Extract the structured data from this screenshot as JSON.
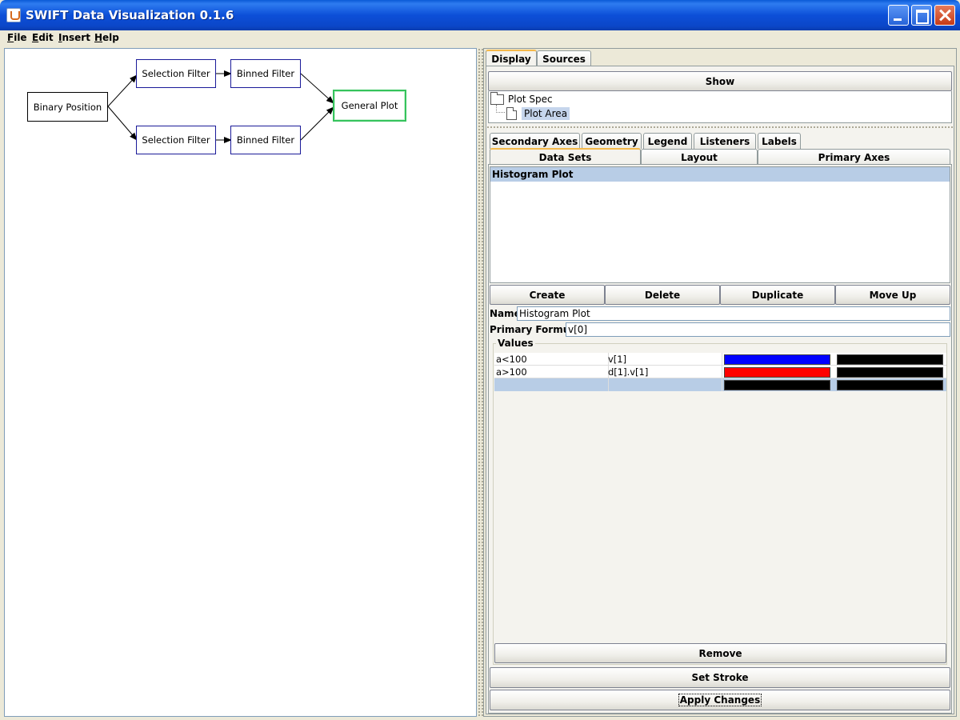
{
  "window": {
    "title": "SWIFT Data Visualization 0.1.6"
  },
  "menu": [
    {
      "accel": "F",
      "rest": "ile"
    },
    {
      "accel": "E",
      "rest": "dit"
    },
    {
      "accel": "I",
      "rest": "nsert"
    },
    {
      "accel": "H",
      "rest": "elp"
    }
  ],
  "graph": {
    "nodes": {
      "binary": "Binary Position",
      "sel_top": "Selection Filter",
      "sel_bottom": "Selection Filter",
      "bin_top": "Binned Filter",
      "bin_bottom": "Binned Filter",
      "plot": "General Plot"
    }
  },
  "top_tabs": [
    "Display",
    "Sources"
  ],
  "show_button": "Show",
  "tree": {
    "root": "Plot Spec",
    "child": "Plot Area"
  },
  "spec_tabs_row1": [
    "Secondary Axes",
    "Geometry",
    "Legend",
    "Listeners",
    "Labels"
  ],
  "spec_tabs_row2": [
    "Data Sets",
    "Layout",
    "Primary Axes"
  ],
  "datasets": {
    "list_header": "Histogram Plot"
  },
  "dataset_buttons": [
    "Create",
    "Delete",
    "Duplicate",
    "Move Up"
  ],
  "form": {
    "name_label": "Name",
    "name_value": "Histogram Plot",
    "formula_label": "Primary Formula",
    "formula_value": "v[0]"
  },
  "values": {
    "title": "Values",
    "rows": [
      {
        "condition": "a<100",
        "formula": "v[1]",
        "fill": "#0000ff",
        "stroke": "#000000"
      },
      {
        "condition": "a>100",
        "formula": "d[1].v[1]",
        "fill": "#ff0000",
        "stroke": "#000000"
      },
      {
        "condition": "",
        "formula": "",
        "fill": "#000000",
        "stroke": "#000000"
      }
    ],
    "remove_button": "Remove"
  },
  "set_stroke_button": "Set Stroke",
  "apply_button": "Apply Changes"
}
